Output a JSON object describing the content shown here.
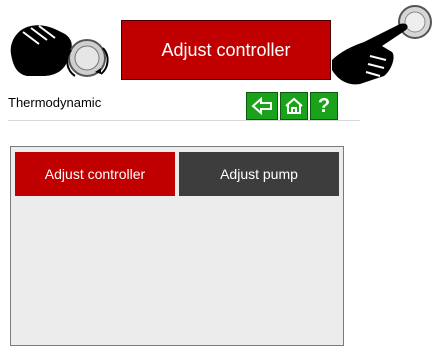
{
  "banner": {
    "button_label": "Adjust controller",
    "left_hand_icon": "hand-rotate-knob-icon",
    "right_hand_icon": "hand-press-icon"
  },
  "header": {
    "title": "Thermodynamic",
    "buttons": [
      {
        "icon": "back-arrow-icon"
      },
      {
        "icon": "home-icon"
      },
      {
        "icon": "help-icon",
        "label": "?"
      }
    ]
  },
  "tabs": [
    {
      "label": "Adjust controller",
      "active": true
    },
    {
      "label": "Adjust pump",
      "active": false
    }
  ],
  "colors": {
    "accent_red": "#c00000",
    "nav_green": "#1aa31a",
    "inactive_tab": "#3d3d3d"
  }
}
